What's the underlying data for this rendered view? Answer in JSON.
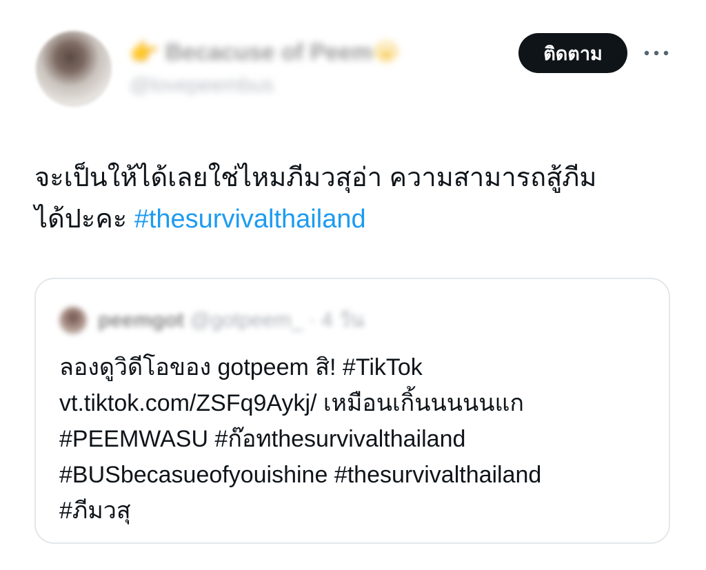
{
  "author": {
    "display_name": "Becacuse of Peem",
    "name_emoji_left": "👉",
    "name_emoji_right": "😭",
    "handle": "@lovepeembus"
  },
  "actions": {
    "follow_label": "ติดตาม",
    "more_label": "···"
  },
  "tweet": {
    "line1": "จะเป็นให้ได้เลยใช่ไหมภีมวสุอ่า ความสามารถสู้ภีม",
    "line2_text": "ได้ปะคะ ",
    "line2_hashtag": "#thesurvivalthailand"
  },
  "quote": {
    "author_name": "peemgot",
    "author_handle": "@gotpeem_",
    "separator": "·",
    "age": "4 วัน",
    "lines": [
      "ลองดูวิดีโอของ gotpeem สิ! #TikTok",
      "vt.tiktok.com/ZSFq9Aykj/ เหมือนเกิ้นนนนนแก",
      "#PEEMWASU #ก๊อทthesurvivalthailand",
      "#BUSbecasueofyouishine #thesurvivalthailand",
      "#ภีมวสุ"
    ]
  },
  "icons": {
    "more": "more-horizontal-icon",
    "avatar": "avatar"
  },
  "colors": {
    "text": "#0f1419",
    "link": "#1d9bf0",
    "button_bg": "#0f1419",
    "button_text": "#ffffff",
    "border": "#e3e7ea",
    "muted": "#536471"
  }
}
